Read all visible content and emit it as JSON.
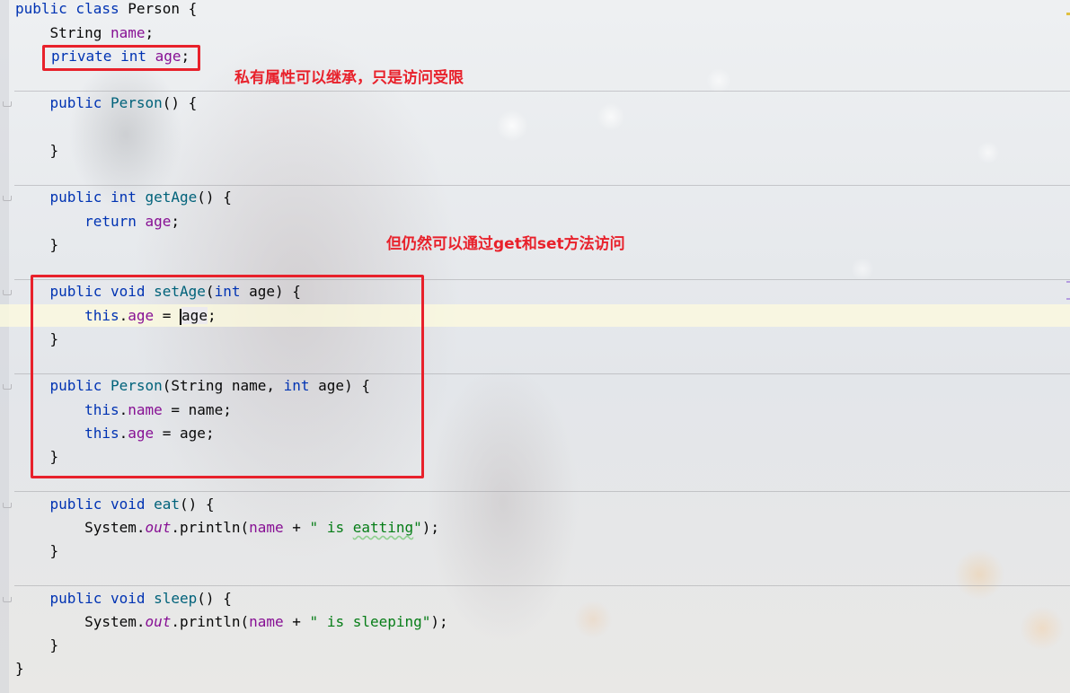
{
  "code": {
    "l01": {
      "a": "public class ",
      "b": "Person {"
    },
    "l02": {
      "a": "    String ",
      "b": "name",
      ";": ";"
    },
    "l03": {
      "a": "private int ",
      "b": "age",
      ";": ";"
    },
    "l05": {
      "a": "    public ",
      "b": "Person",
      "c": "() {"
    },
    "l07": {
      "a": "    }"
    },
    "l09": {
      "a": "    public int ",
      "b": "getAge",
      "c": "() {"
    },
    "l10": {
      "a": "        return ",
      "b": "age",
      ";": ";"
    },
    "l11": {
      "a": "    }"
    },
    "l13": {
      "a": "    public void ",
      "b": "setAge",
      "c": "(",
      "d": "int",
      " e": " age) {"
    },
    "l14": {
      "a": "        this",
      ".": ".",
      "b": "age",
      "c": " = ",
      "d": "age",
      ";": ";"
    },
    "l15": {
      "a": "    }"
    },
    "l17": {
      "a": "    public ",
      "b": "Person",
      "c": "(String name, ",
      "d": "int",
      "e": " age) {"
    },
    "l18": {
      "a": "        this",
      ".": ".",
      "b": "name",
      "c": " = name;"
    },
    "l19": {
      "a": "        this",
      ".": ".",
      "b": "age",
      "c": " = age;"
    },
    "l20": {
      "a": "    }"
    },
    "l22": {
      "a": "    public void ",
      "b": "eat",
      "c": "() {"
    },
    "l23": {
      "a": "        System.",
      "b": "out",
      "c": ".println(",
      "d": "name",
      "e": " + ",
      "f": "\" is ",
      "g": "eatting",
      "h": "\"",
      ";": ");"
    },
    "l24": {
      "a": "    }"
    },
    "l26": {
      "a": "    public void ",
      "b": "sleep",
      "c": "() {"
    },
    "l27": {
      "a": "        System.",
      "b": "out",
      "c": ".println(",
      "d": "name",
      "e": " + ",
      "f": "\" is sleeping\"",
      ";": ");"
    },
    "l28": {
      "a": "    }"
    },
    "l29": {
      "a": "}"
    }
  },
  "annotations": {
    "private_note": "私有属性可以继承，只是访问受限",
    "getset_note": "但仍然可以通过get和set方法访问"
  },
  "colors": {
    "keyword": "#0033b3",
    "method": "#00627a",
    "field": "#871094",
    "string": "#067d17",
    "annotation": "#e8212b"
  }
}
